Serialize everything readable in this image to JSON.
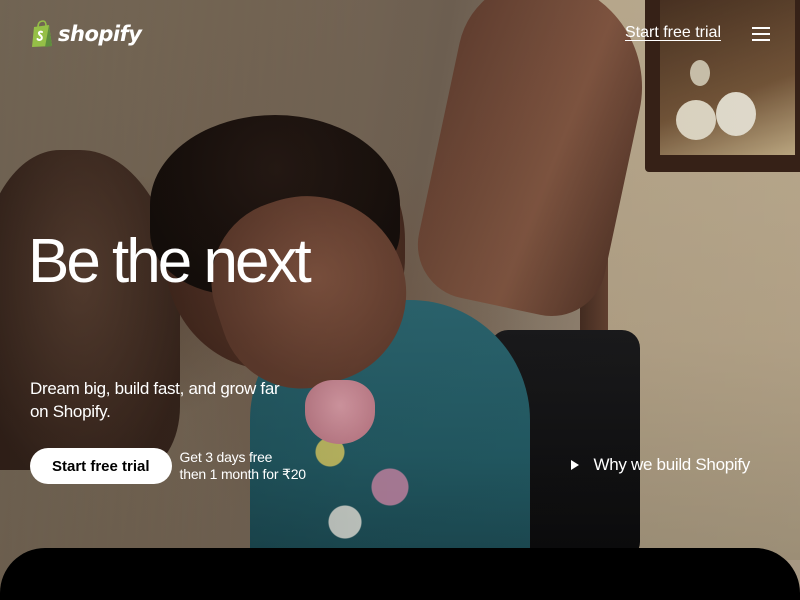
{
  "header": {
    "logo_text": "shopify",
    "nav_trial_label": "Start free trial",
    "menu_icon": "hamburger-menu-icon"
  },
  "hero": {
    "headline": "Be the next",
    "subhead": "Dream big, build fast, and grow far on Shopify.",
    "cta_label": "Start free trial",
    "cta_note_line1": "Get 3 days free",
    "cta_note_line2": "then 1 month for ₹20",
    "why_link_label": "Why we build Shopify",
    "why_link_icon": "play-icon"
  },
  "colors": {
    "text": "#ffffff",
    "cta_bg": "#ffffff",
    "cta_text": "#000000",
    "logo_green": "#95bf47",
    "bottom_panel": "#000000"
  }
}
